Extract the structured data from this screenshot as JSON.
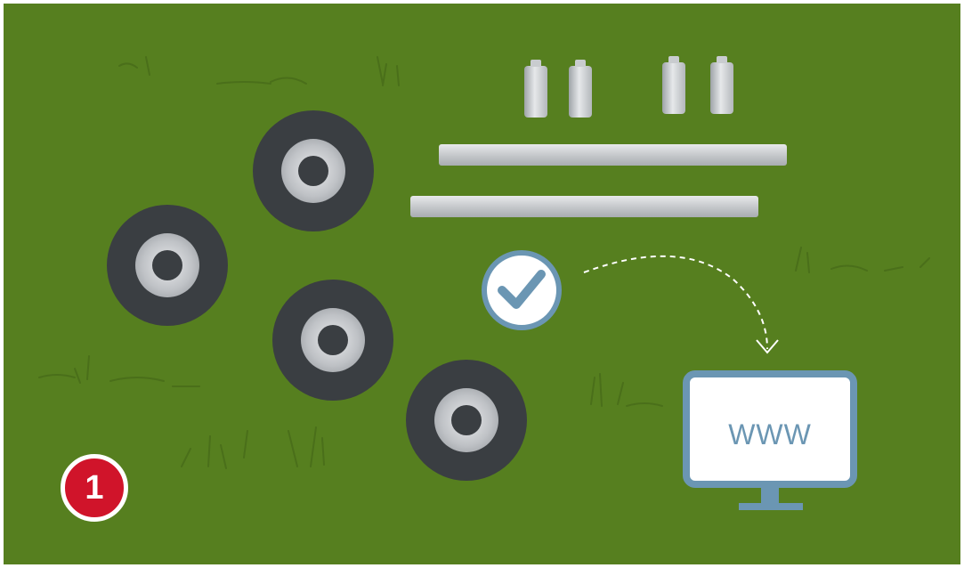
{
  "scene": {
    "step_badge": {
      "label": "1",
      "color": "#d0142a"
    },
    "monitor": {
      "label": "WWW",
      "color": "#6b96b3"
    },
    "background_color": "#567f1f",
    "tire_color": "#3a3e42",
    "icons": [
      "tire-icon",
      "battery-cell-icon",
      "metal-bar-icon",
      "checkmark-icon",
      "dashed-arrow-icon",
      "computer-monitor-icon"
    ]
  }
}
